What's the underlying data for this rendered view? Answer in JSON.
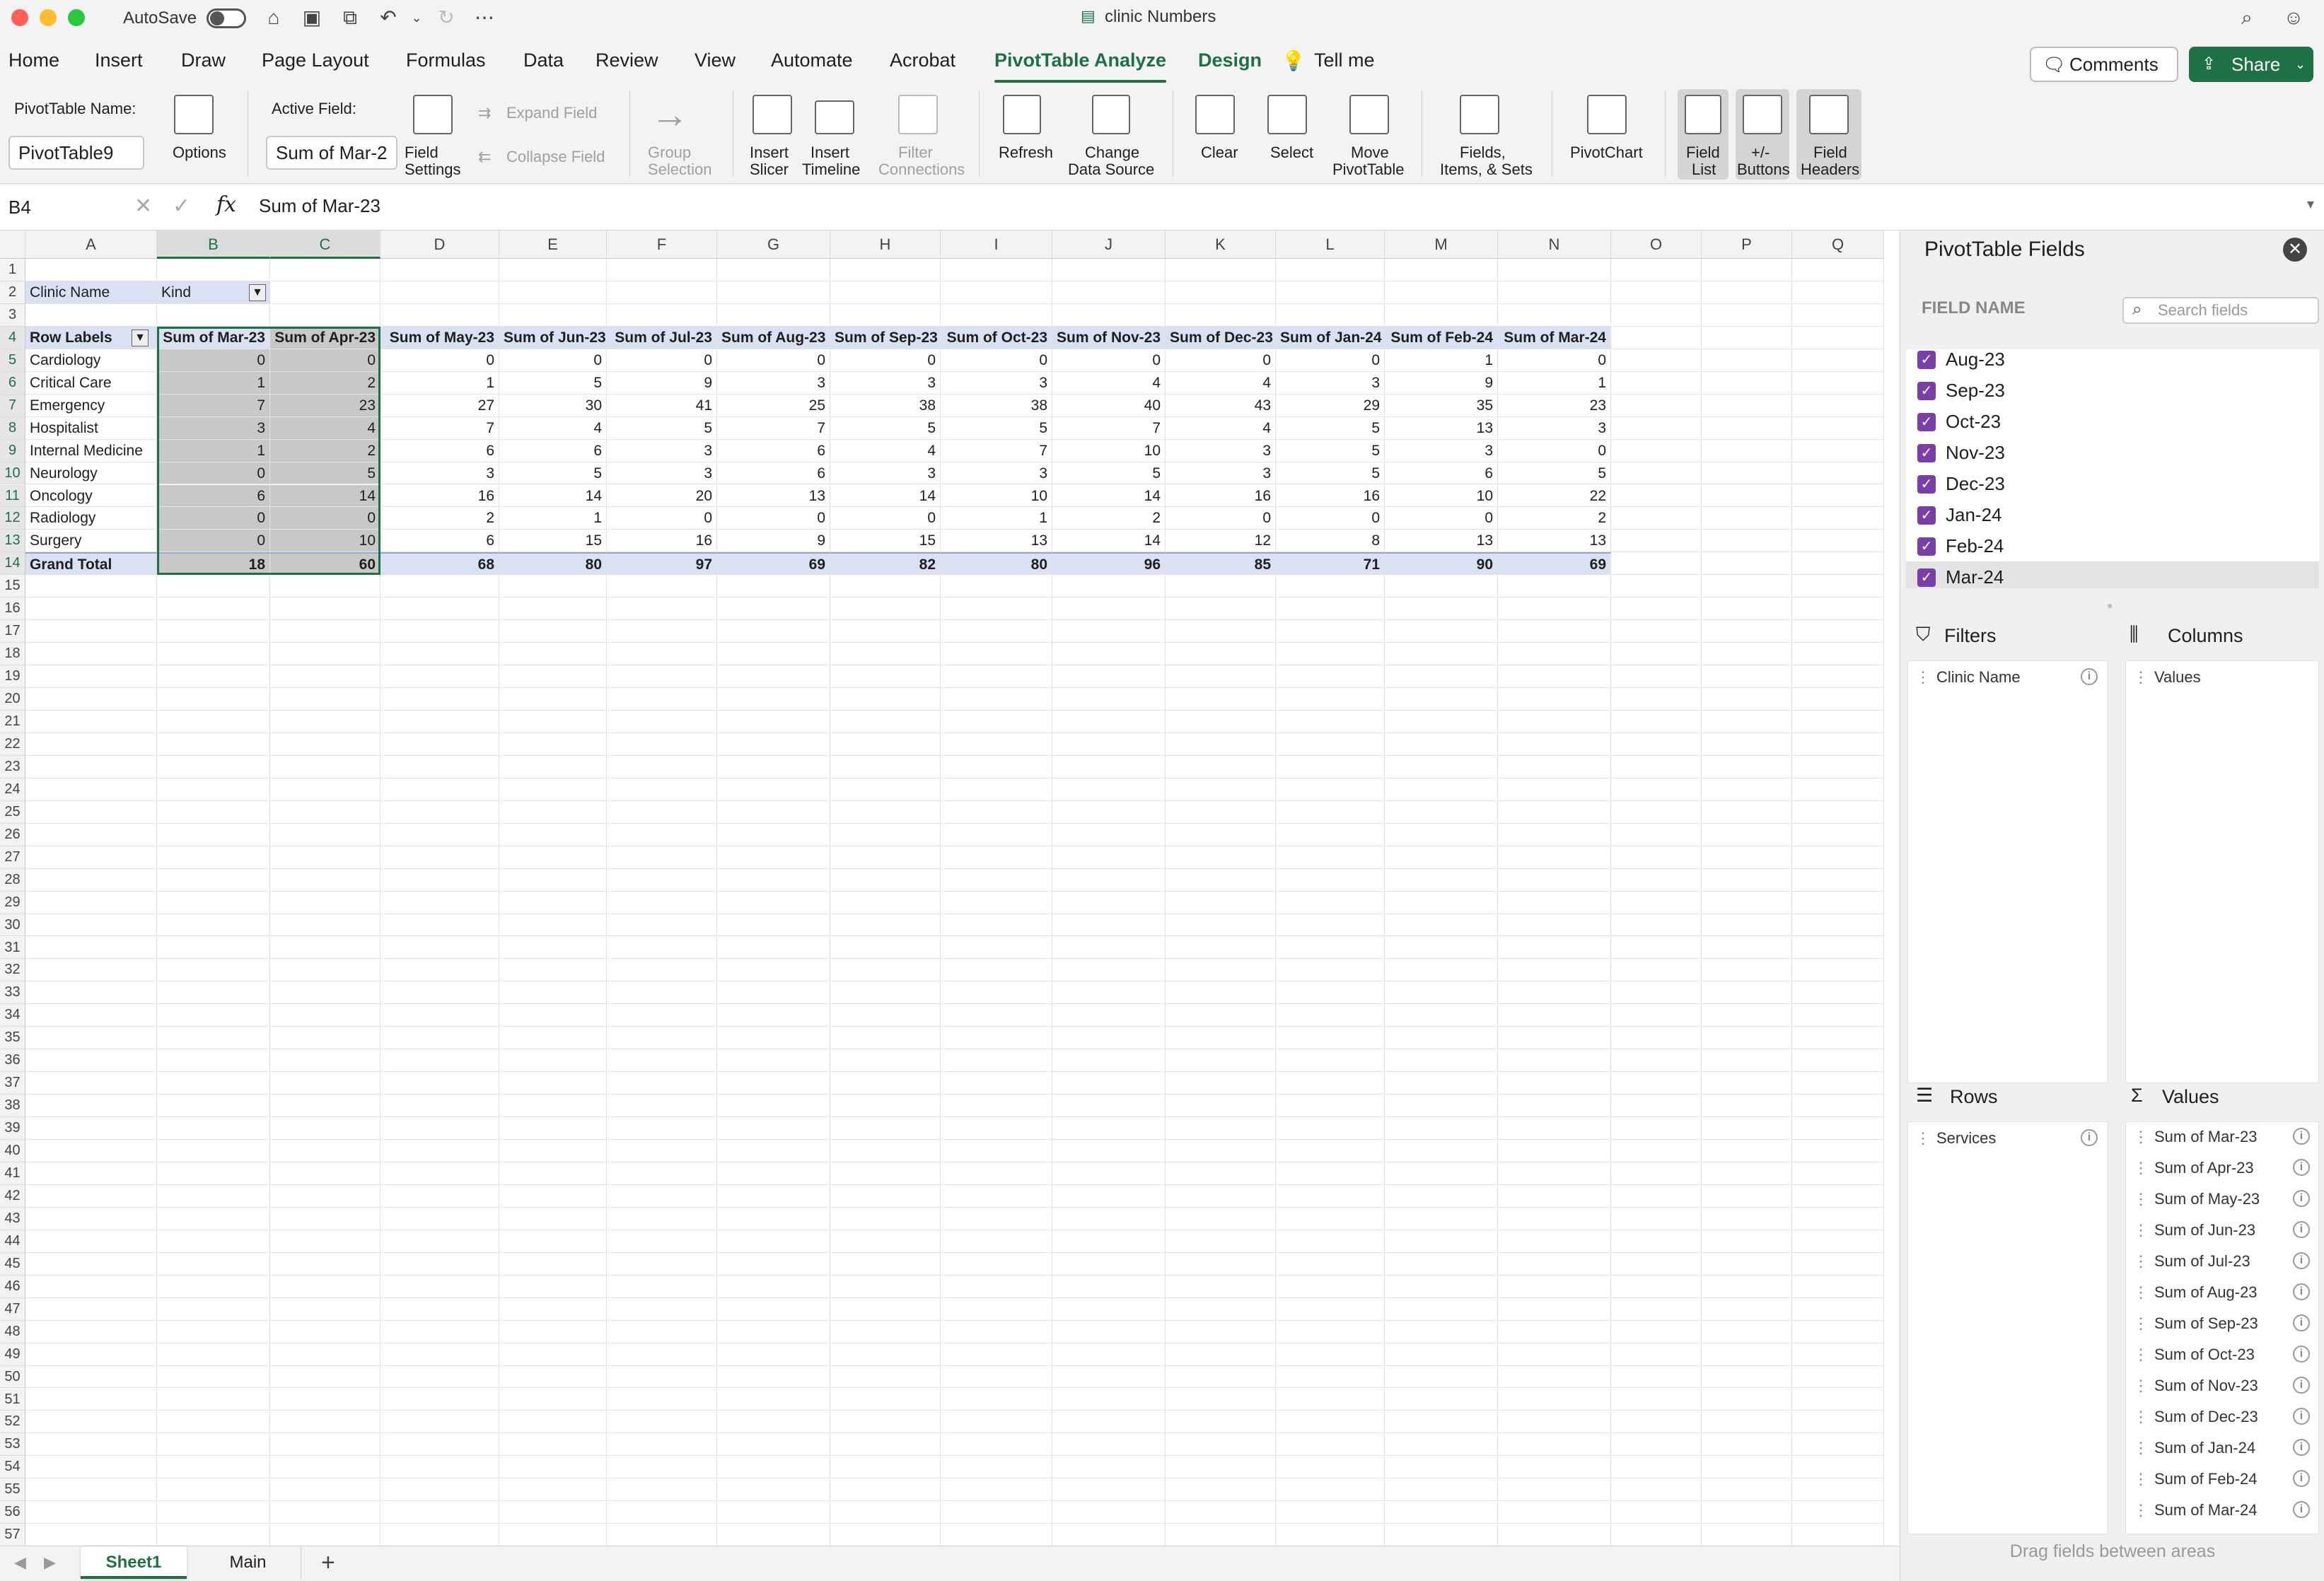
{
  "title_bar": {
    "autosave_label": "AutoSave",
    "doc_title": "clinic Numbers"
  },
  "menu": {
    "tabs": [
      "Home",
      "Insert",
      "Draw",
      "Page Layout",
      "Formulas",
      "Data",
      "Review",
      "View",
      "Automate",
      "Acrobat",
      "PivotTable Analyze",
      "Design"
    ],
    "tell_me": "Tell me",
    "comments": "Comments",
    "share": "Share"
  },
  "ribbon": {
    "pt_name_label": "PivotTable Name:",
    "pt_name_value": "PivotTable9",
    "options": "Options",
    "active_field_label": "Active Field:",
    "active_field_value": "Sum of Mar-2",
    "field_settings": [
      "Field",
      "Settings"
    ],
    "expand_field": "Expand Field",
    "collapse_field": "Collapse Field",
    "group_selection": [
      "Group",
      "Selection"
    ],
    "insert_slicer": [
      "Insert",
      "Slicer"
    ],
    "insert_timeline": [
      "Insert",
      "Timeline"
    ],
    "filter_connections": [
      "Filter",
      "Connections"
    ],
    "refresh": "Refresh",
    "change_data_source": [
      "Change",
      "Data Source"
    ],
    "clear": "Clear",
    "select": "Select",
    "move_pivottable": [
      "Move",
      "PivotTable"
    ],
    "fields_items_sets": [
      "Fields,",
      "Items, & Sets"
    ],
    "pivotchart": "PivotChart",
    "field_list": [
      "Field",
      "List"
    ],
    "plus_minus": [
      "+/-",
      "Buttons"
    ],
    "field_headers": [
      "Field",
      "Headers"
    ]
  },
  "formula_bar": {
    "name_box": "B4",
    "formula": "Sum of Mar-23"
  },
  "sheet": {
    "columns": [
      "A",
      "B",
      "C",
      "D",
      "E",
      "F",
      "G",
      "H",
      "I",
      "J",
      "K",
      "L",
      "M",
      "N",
      "O",
      "P",
      "Q"
    ],
    "filter_row": {
      "label": "Clinic Name",
      "value": "Kind"
    },
    "headers": [
      "Row Labels",
      "Sum of Mar-23",
      "Sum of Apr-23",
      "Sum of May-23",
      "Sum of Jun-23",
      "Sum of Jul-23",
      "Sum of Aug-23",
      "Sum of Sep-23",
      "Sum of Oct-23",
      "Sum of Nov-23",
      "Sum of Dec-23",
      "Sum of Jan-24",
      "Sum of Feb-24",
      "Sum of Mar-24"
    ],
    "rows": [
      [
        "Cardiology",
        0,
        0,
        0,
        0,
        0,
        0,
        0,
        0,
        0,
        0,
        0,
        1,
        0
      ],
      [
        "Critical Care",
        1,
        2,
        1,
        5,
        9,
        3,
        3,
        3,
        4,
        4,
        3,
        9,
        1
      ],
      [
        "Emergency",
        7,
        23,
        27,
        30,
        41,
        25,
        38,
        38,
        40,
        43,
        29,
        35,
        23
      ],
      [
        "Hospitalist",
        3,
        4,
        7,
        4,
        5,
        7,
        5,
        5,
        7,
        4,
        5,
        13,
        3
      ],
      [
        "Internal Medicine",
        1,
        2,
        6,
        6,
        3,
        6,
        4,
        7,
        10,
        3,
        5,
        3,
        0
      ],
      [
        "Neurology",
        0,
        5,
        3,
        5,
        3,
        6,
        3,
        3,
        5,
        3,
        5,
        6,
        5
      ],
      [
        "Oncology",
        6,
        14,
        16,
        14,
        20,
        13,
        14,
        10,
        14,
        16,
        16,
        10,
        22
      ],
      [
        "Radiology",
        0,
        0,
        2,
        1,
        0,
        0,
        0,
        1,
        2,
        0,
        0,
        0,
        2
      ],
      [
        "Surgery",
        0,
        10,
        6,
        15,
        16,
        9,
        15,
        13,
        14,
        12,
        8,
        13,
        13
      ]
    ],
    "total": [
      "Grand Total",
      18,
      60,
      68,
      80,
      97,
      69,
      82,
      80,
      96,
      85,
      71,
      90,
      69
    ],
    "tabs": [
      "Sheet1",
      "Main"
    ]
  },
  "pane": {
    "title": "PivotTable Fields",
    "field_name": "FIELD NAME",
    "search_placeholder": "Search fields",
    "fields": [
      "Aug-23",
      "Sep-23",
      "Oct-23",
      "Nov-23",
      "Dec-23",
      "Jan-24",
      "Feb-24",
      "Mar-24"
    ],
    "filters_label": "Filters",
    "filters": [
      "Clinic Name"
    ],
    "columns_label": "Columns",
    "columns": [
      "Values"
    ],
    "rows_label": "Rows",
    "rows": [
      "Services"
    ],
    "values_label": "Values",
    "values": [
      "Sum of Mar-23",
      "Sum of Apr-23",
      "Sum of May-23",
      "Sum of Jun-23",
      "Sum of Jul-23",
      "Sum of Aug-23",
      "Sum of Sep-23",
      "Sum of Oct-23",
      "Sum of Nov-23",
      "Sum of Dec-23",
      "Sum of Jan-24",
      "Sum of Feb-24",
      "Sum of Mar-24"
    ],
    "drag_hint": "Drag fields between areas"
  }
}
